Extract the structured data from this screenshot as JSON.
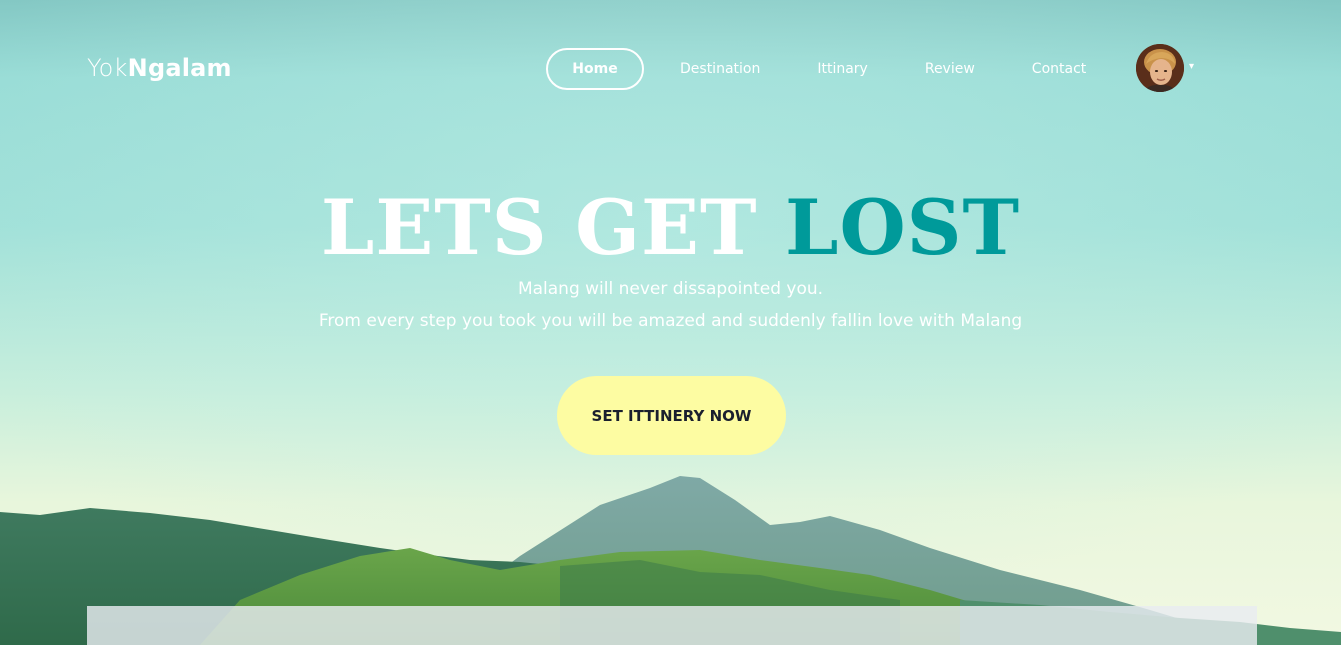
{
  "brand": {
    "logo_light": "Yok",
    "logo_bold": "Ngalam"
  },
  "nav": {
    "items": [
      {
        "label": "Home",
        "active": true
      },
      {
        "label": "Destination",
        "active": false
      },
      {
        "label": "Ittinary",
        "active": false
      },
      {
        "label": "Review",
        "active": false
      },
      {
        "label": "Contact",
        "active": false
      }
    ]
  },
  "user": {
    "avatar_icon": "user-avatar",
    "menu_caret": "▾"
  },
  "hero": {
    "headline_white": "LETS GET",
    "headline_accent": "LOST",
    "subtitle_1": "Malang will never dissapointed you.",
    "subtitle_2": "From every step you took you will be amazed and suddenly fallin love with Malang",
    "cta_label": "SET ITTINERY NOW"
  },
  "colors": {
    "accent": "#009a9a",
    "cta_background": "#fdfca2",
    "cta_text": "#1a1f2e"
  }
}
